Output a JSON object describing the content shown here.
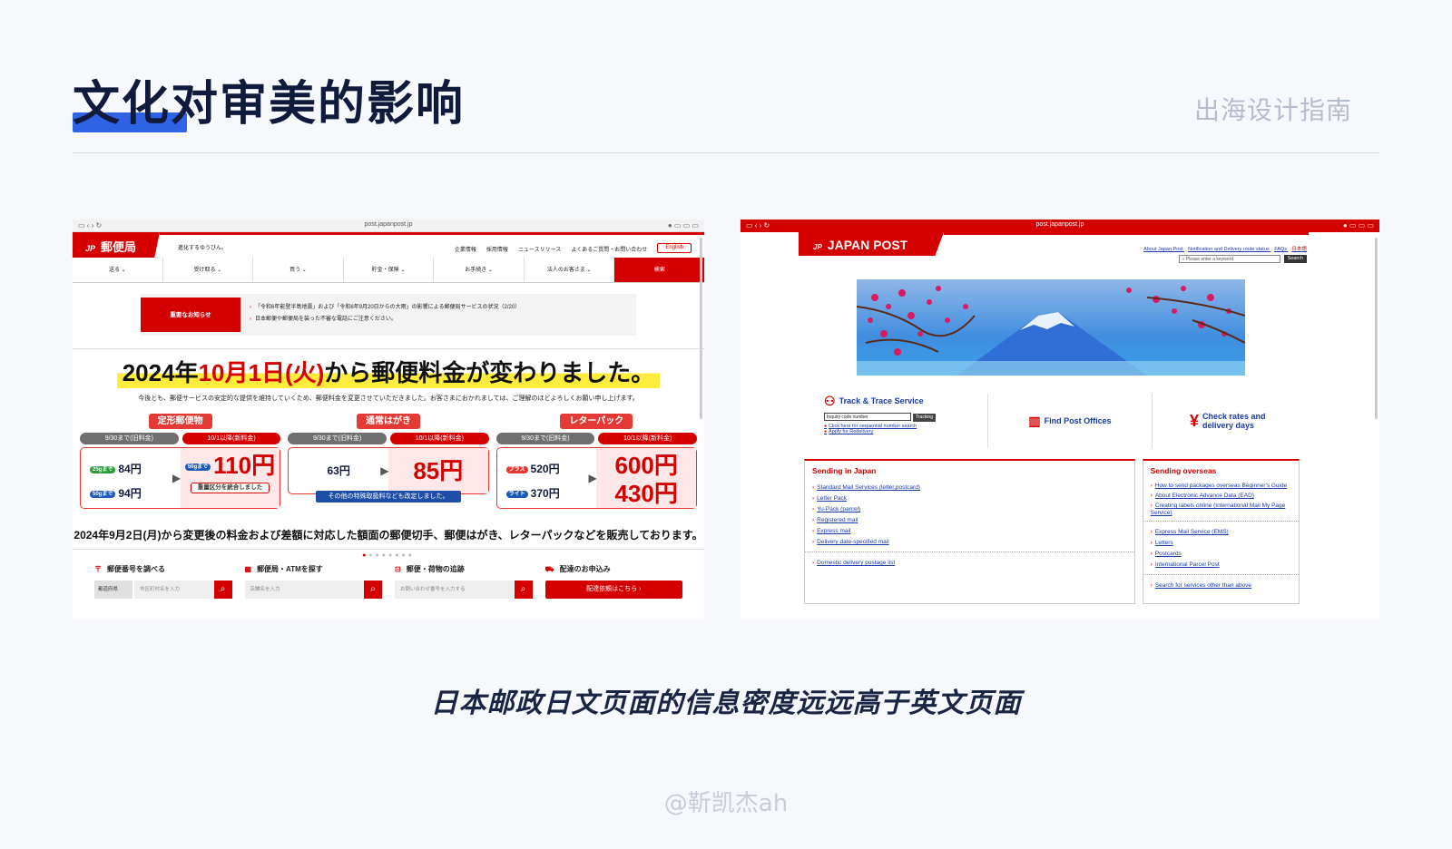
{
  "slide": {
    "title": "文化对审美的影响",
    "subtitle": "出海设计指南",
    "caption": "日本邮政日文页面的信息密度远远高于英文页面",
    "watermark": "@靳凯杰ah",
    "accent": "#2e63e6"
  },
  "jp_site": {
    "url": "post.japanpost.jp",
    "logo": "郵便局",
    "logo_mark": "JP",
    "tagline": "進化するゆうびん。",
    "header_links": [
      "企業情報",
      "採用情報",
      "ニュースリリース",
      "よくあるご質問・お問い合わせ"
    ],
    "lang_button": "English",
    "nav": [
      "送る ⌄",
      "受け取る ⌄",
      "買う ⌄",
      "貯金・保険 ⌄",
      "お手続き ⌄",
      "法人のお客さま ⌄",
      "検索"
    ],
    "notice_label": "重要なお知らせ",
    "notices": [
      "「令和6年能登半島地震」および「令和6年9月20日からの大雨」の影響による郵便局サービスの状況（2/20）",
      "日本郵便や郵便局を装った不審な電話にご注意ください。"
    ],
    "banner": {
      "title_year": "2024年",
      "title_date": "10月1日(火)",
      "title_rest": "から郵便料金が変わりました。",
      "note": "今後とも、郵便サービスの安定的な提供を維持していくため、郵便料金を変更させていただきました。お客さまにおかれましては、ご理解のほどよろしくお願い申し上げます。",
      "cards": [
        {
          "title": "定形郵便物",
          "old_label": "9/30まで(旧料金)",
          "new_label": "10/1以降(新料金)",
          "rows": [
            {
              "badge": "25gまで",
              "price": "84円"
            },
            {
              "badge": "50gまで",
              "price": "94円"
            }
          ],
          "new_badge": "50gまで",
          "new_price": "110円",
          "note": "重量区分を統合しました"
        },
        {
          "title": "通常はがき",
          "old_label": "9/30まで(旧料金)",
          "new_label": "10/1以降(新料金)",
          "old_price": "63円",
          "new_price": "85円",
          "note": "その他の特殊取扱料なども改定しました。"
        },
        {
          "title": "レターパック",
          "old_label": "9/30まで(旧料金)",
          "new_label": "10/1以降(新料金)",
          "rows": [
            {
              "badge": "プラス",
              "price": "520円"
            },
            {
              "badge": "ライト",
              "price": "370円"
            }
          ],
          "new_prices": [
            "600円",
            "430円"
          ]
        }
      ],
      "footer": "2024年9月2日(月)から変更後の料金および差額に対応した額面の郵便切手、郵便はがき、レターパックなどを販売しております。"
    },
    "tools": [
      {
        "title": "郵便番号を調べる",
        "select": "都道府県",
        "placeholder": "市区町村名を入力"
      },
      {
        "title": "郵便局・ATMを探す",
        "placeholder": "店舗名を入力"
      },
      {
        "title": "郵便・荷物の追跡",
        "placeholder": "お問い合わせ番号を入力する"
      },
      {
        "title": "配達のお申込み",
        "button": "配達依頼はこちら ›"
      }
    ]
  },
  "en_site": {
    "url": "post.japanpost.jp",
    "logo": "JAPAN POST",
    "logo_mark": "JP",
    "header_links": [
      "About Japan Post",
      "Notification and Delivery route status",
      "FAQs",
      "日本語"
    ],
    "search_placeholder": "Please enter a keyword",
    "search_button": "Search",
    "track": {
      "title": "Track & Trace Service",
      "input": "Inquiry code number",
      "button": "Tracking",
      "links": [
        "Click here for sequential number search",
        "Apply for Redelivery"
      ]
    },
    "find": "Find Post Offices",
    "rates": "Check rates and delivery days",
    "japan": {
      "title": "Sending in Japan",
      "links": [
        "Standard Mail Services (letter,postcard)",
        "Letter Pack",
        "Yu-Pack (parcel)",
        "Registered mail",
        "Express mail",
        "Delivery date-specified mail"
      ],
      "extra": "Domestic delivery postage list"
    },
    "overseas": {
      "title": "Sending overseas",
      "links_a": [
        "How to send packages overseas Beginner's Guide",
        "About Electronic Advance Data (EAD)",
        "Creating labels online (International Mail My Page Service)"
      ],
      "links_b": [
        "Express Mail Service (EMS)",
        "Letters",
        "Postcards",
        "International Parcel Post"
      ],
      "extra": "Search for services other than above"
    }
  }
}
